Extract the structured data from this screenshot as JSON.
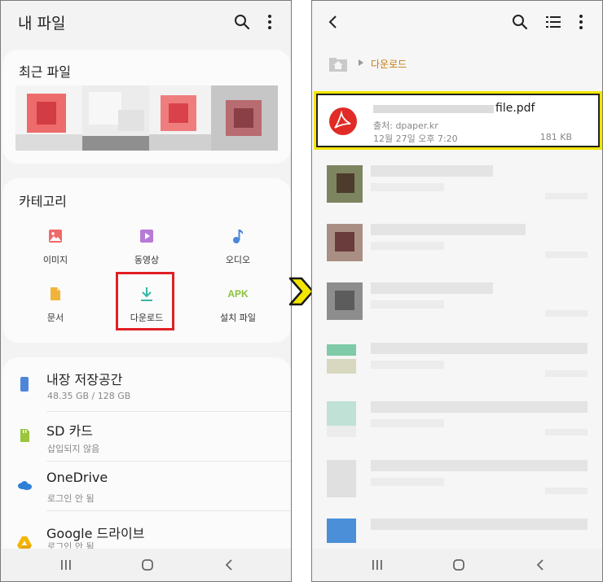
{
  "left": {
    "title": "내 파일",
    "recent": {
      "title": "최근 파일"
    },
    "category": {
      "title": "카테고리",
      "items": [
        {
          "label": "이미지",
          "icon": "image-icon",
          "color": "#f0686a"
        },
        {
          "label": "동영상",
          "icon": "video-icon",
          "color": "#b77ad7"
        },
        {
          "label": "오디오",
          "icon": "music-note-icon",
          "color": "#4d86d8"
        },
        {
          "label": "문서",
          "icon": "document-icon",
          "color": "#f1b43b"
        },
        {
          "label": "다운로드",
          "icon": "download-icon",
          "color": "#35b7a8"
        },
        {
          "label": "설치 파일",
          "icon": "apk-icon",
          "color": "#8ac23c",
          "text": "APK"
        }
      ]
    },
    "storage": [
      {
        "name": "내장 저장공간",
        "sub": "48.35 GB / 128 GB",
        "icon": "phone-storage-icon"
      },
      {
        "name": "SD 카드",
        "sub": "삽입되지 않음",
        "icon": "sd-card-icon"
      },
      {
        "name": "OneDrive",
        "sub": "로그인 안 됨",
        "icon": "onedrive-icon"
      },
      {
        "name": "Google 드라이브",
        "sub": "로그인 안 됨",
        "icon": "google-drive-icon"
      }
    ]
  },
  "right": {
    "breadcrumb": "다운로드",
    "file": {
      "name_suffix": "file.pdf",
      "source": "출처: dpaper.kr",
      "date": "12월 27일 오후 7:20",
      "size": "181 KB",
      "icon": "pdf-icon",
      "color": "#e02b26"
    }
  },
  "highlight_color": "#e02025",
  "selection_color": "#f2e600"
}
